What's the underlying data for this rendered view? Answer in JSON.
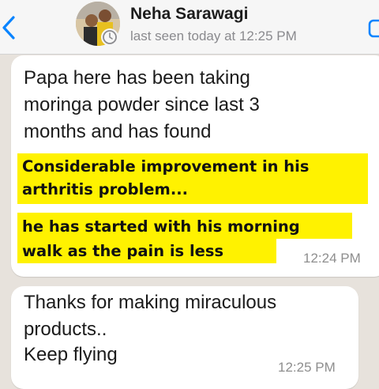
{
  "header": {
    "contact_name": "Neha Sarawagi",
    "last_seen": "last seen today at 12:25 PM",
    "back_icon": "chevron-left-icon",
    "call_icon": "phone-icon"
  },
  "messages": [
    {
      "lines": [
        "Papa here has been taking",
        "moringa powder since last 3",
        "months and has found"
      ],
      "highlights": [
        "Considerable improvement in his",
        "arthritis problem...",
        "he has started with his morning",
        "walk as the pain is less"
      ],
      "time": "12:24 PM"
    },
    {
      "lines": [
        "Thanks for making miraculous",
        "products..",
        "Keep flying"
      ],
      "time": "12:25 PM"
    }
  ],
  "colors": {
    "highlight": "#fff200",
    "accent": "#0a84ff",
    "background": "#e7e2dc"
  }
}
